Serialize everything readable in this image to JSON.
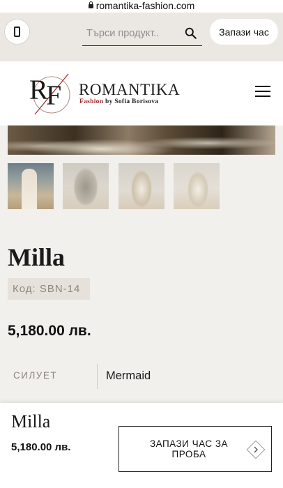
{
  "browser": {
    "url": "romantika-fashion.com"
  },
  "topbar": {
    "search_placeholder": "Търси продукт..",
    "book_button": "Запази час"
  },
  "header": {
    "brand": "ROMANTIKA",
    "tagline_prefix": "Fashion",
    "tagline_suffix": " by Sofia Borisova",
    "logo_monogram": "RF"
  },
  "product": {
    "title": "Milla",
    "code": "Код: SBN-14",
    "price": "5,180.00 лв.",
    "attributes": [
      {
        "label": "СИЛУЕТ",
        "value": "Mermaid"
      }
    ]
  },
  "sticky": {
    "title": "Milla",
    "price": "5,180.00 лв.",
    "cta_label": "ЗАПАЗИ ЧАС ЗА ПРОБА"
  },
  "colors": {
    "accent_red": "#a0262b",
    "top_bar_bg": "#ebe8e3",
    "page_bg": "#f2f0ed",
    "badge_bg": "#e6e1db"
  }
}
